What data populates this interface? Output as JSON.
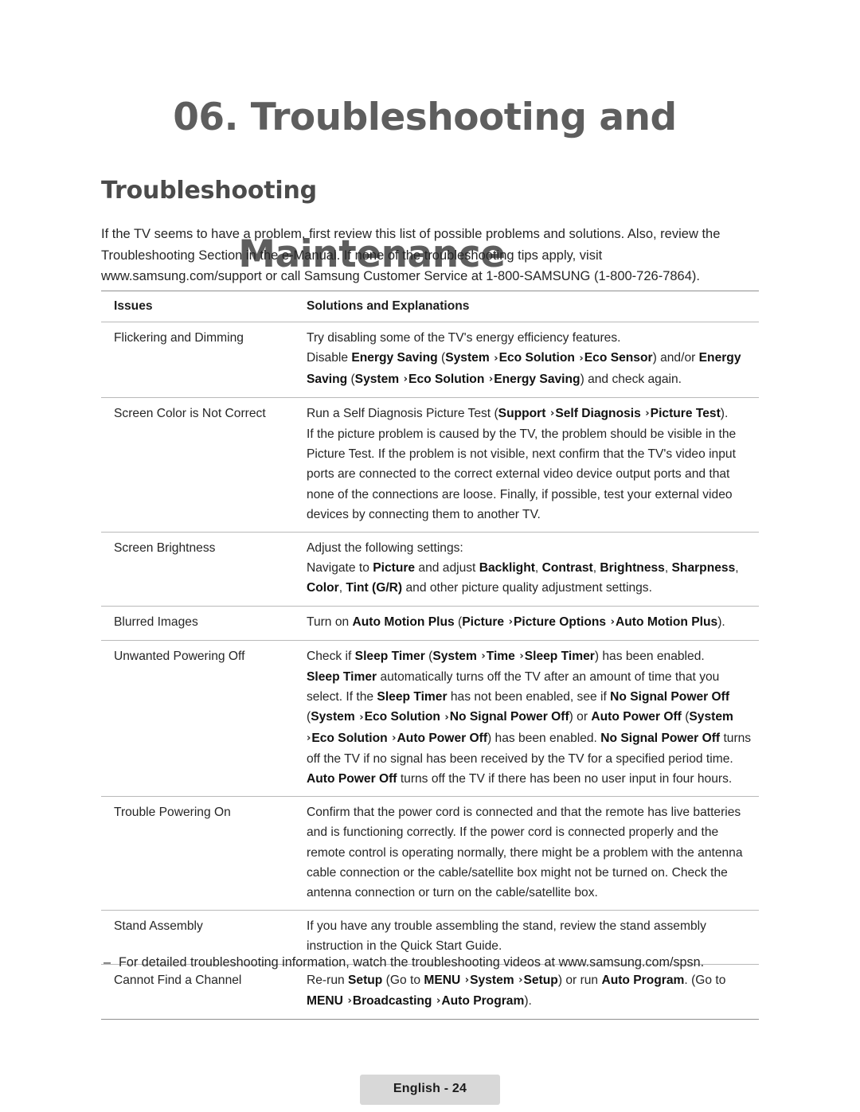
{
  "chapter": {
    "line1": "06. Troubleshooting and",
    "line2": "Maintenance"
  },
  "section": {
    "title": "Troubleshooting"
  },
  "intro": {
    "text": "If the TV seems to have a problem, first review this list of possible problems and solutions. Also, review the Troubleshooting Section in the e-Manual. If none of the troubleshooting tips apply, visit www.samsung.com/support or call Samsung Customer Service at 1-800-SAMSUNG (1-800-726-7864)."
  },
  "table": {
    "headers": {
      "issues": "Issues",
      "solutions": "Solutions and Explanations"
    },
    "rows": [
      {
        "issue": "Flickering and Dimming",
        "paragraphs": [
          [
            {
              "t": "Try disabling some of the TV's energy efficiency features."
            }
          ],
          [
            {
              "t": "Disable "
            },
            {
              "t": "Energy Saving",
              "b": true
            },
            {
              "t": " ("
            },
            {
              "t": "System",
              "b": true
            },
            {
              "t": " ",
              "chev": true
            },
            {
              "t": "Eco Solution",
              "b": true
            },
            {
              "t": " ",
              "chev": true
            },
            {
              "t": "Eco Sensor",
              "b": true
            },
            {
              "t": ") and/or "
            },
            {
              "t": "Energy Saving",
              "b": true
            },
            {
              "t": " ("
            },
            {
              "t": "System",
              "b": true
            },
            {
              "t": " ",
              "chev": true
            },
            {
              "t": "Eco Solution",
              "b": true
            },
            {
              "t": " ",
              "chev": true
            },
            {
              "t": "Energy Saving",
              "b": true
            },
            {
              "t": ") and check again."
            }
          ]
        ]
      },
      {
        "issue": "Screen Color is Not Correct",
        "paragraphs": [
          [
            {
              "t": "Run a Self Diagnosis Picture Test ("
            },
            {
              "t": "Support",
              "b": true
            },
            {
              "t": " ",
              "chev": true
            },
            {
              "t": "Self Diagnosis",
              "b": true
            },
            {
              "t": " ",
              "chev": true
            },
            {
              "t": "Picture Test",
              "b": true
            },
            {
              "t": ")."
            }
          ],
          [
            {
              "t": "If the picture problem is caused by the TV, the problem should be visible in the Picture Test. If the problem is not visible, next confirm that the TV's video input ports are connected to the correct external video device output ports and that none of the connections are loose. Finally, if possible, test your external video devices by connecting them to another TV."
            }
          ]
        ]
      },
      {
        "issue": "Screen Brightness",
        "paragraphs": [
          [
            {
              "t": "Adjust the following settings:"
            }
          ],
          [
            {
              "t": "Navigate to "
            },
            {
              "t": "Picture",
              "b": true
            },
            {
              "t": " and adjust "
            },
            {
              "t": "Backlight",
              "b": true
            },
            {
              "t": ", "
            },
            {
              "t": "Contrast",
              "b": true
            },
            {
              "t": ", "
            },
            {
              "t": "Brightness",
              "b": true
            },
            {
              "t": ", "
            },
            {
              "t": "Sharpness",
              "b": true
            },
            {
              "t": ", "
            },
            {
              "t": "Color",
              "b": true
            },
            {
              "t": ", "
            },
            {
              "t": "Tint (G/R)",
              "b": true
            },
            {
              "t": " and other picture quality adjustment settings."
            }
          ]
        ]
      },
      {
        "issue": "Blurred Images",
        "paragraphs": [
          [
            {
              "t": "Turn on "
            },
            {
              "t": "Auto Motion Plus",
              "b": true
            },
            {
              "t": " ("
            },
            {
              "t": "Picture",
              "b": true
            },
            {
              "t": " ",
              "chev": true
            },
            {
              "t": "Picture Options",
              "b": true
            },
            {
              "t": " ",
              "chev": true
            },
            {
              "t": "Auto Motion Plus",
              "b": true
            },
            {
              "t": ")."
            }
          ]
        ]
      },
      {
        "issue": "Unwanted Powering Off",
        "paragraphs": [
          [
            {
              "t": "Check if "
            },
            {
              "t": "Sleep Timer",
              "b": true
            },
            {
              "t": " ("
            },
            {
              "t": "System",
              "b": true
            },
            {
              "t": " ",
              "chev": true
            },
            {
              "t": "Time",
              "b": true
            },
            {
              "t": " ",
              "chev": true
            },
            {
              "t": "Sleep Timer",
              "b": true
            },
            {
              "t": ") has been enabled."
            }
          ],
          [
            {
              "t": "Sleep Timer",
              "b": true
            },
            {
              "t": " automatically turns off the TV after an amount of time that you select. If the "
            },
            {
              "t": "Sleep Timer",
              "b": true
            },
            {
              "t": " has not been enabled, see if "
            },
            {
              "t": "No Signal Power Off",
              "b": true
            },
            {
              "t": " ("
            },
            {
              "t": "System",
              "b": true
            },
            {
              "t": " ",
              "chev": true
            },
            {
              "t": "Eco Solution",
              "b": true
            },
            {
              "t": " ",
              "chev": true
            },
            {
              "t": "No Signal Power Off",
              "b": true
            },
            {
              "t": ") or "
            },
            {
              "t": "Auto Power Off",
              "b": true
            },
            {
              "t": " ("
            },
            {
              "t": "System",
              "b": true
            },
            {
              "t": " ",
              "chev": true
            },
            {
              "t": "Eco Solution",
              "b": true
            },
            {
              "t": " ",
              "chev": true
            },
            {
              "t": "Auto Power Off",
              "b": true
            },
            {
              "t": ") has been enabled. "
            },
            {
              "t": "No Signal Power Off",
              "b": true
            },
            {
              "t": " turns off the TV if no signal has been received by the TV for a specified period time. "
            },
            {
              "t": "Auto Power Off",
              "b": true
            },
            {
              "t": " turns off the TV if there has been no user input in four hours."
            }
          ]
        ]
      },
      {
        "issue": "Trouble Powering On",
        "paragraphs": [
          [
            {
              "t": "Confirm that the power cord is connected and that the remote has live batteries and is functioning correctly. If the power cord is connected properly and the remote control is operating normally, there might be a problem with the antenna cable connection or the cable/satellite box might not be turned on. Check the antenna connection or turn on the cable/satellite box."
            }
          ]
        ]
      },
      {
        "issue": "Stand Assembly",
        "paragraphs": [
          [
            {
              "t": "If you have any trouble assembling the stand, review the stand assembly instruction in the Quick Start Guide."
            }
          ]
        ]
      },
      {
        "issue": "Cannot Find a Channel",
        "paragraphs": [
          [
            {
              "t": "Re-run "
            },
            {
              "t": "Setup",
              "b": true
            },
            {
              "t": " (Go to "
            },
            {
              "t": "MENU",
              "b": true
            },
            {
              "t": " ",
              "chev": true
            },
            {
              "t": "System",
              "b": true
            },
            {
              "t": " ",
              "chev": true
            },
            {
              "t": "Setup",
              "b": true
            },
            {
              "t": ") or run "
            },
            {
              "t": "Auto Program",
              "b": true
            },
            {
              "t": ". (Go to "
            },
            {
              "t": "MENU",
              "b": true
            },
            {
              "t": " ",
              "chev": true
            },
            {
              "t": "Broadcasting",
              "b": true
            },
            {
              "t": " ",
              "chev": true
            },
            {
              "t": "Auto Program",
              "b": true
            },
            {
              "t": ")."
            }
          ]
        ]
      }
    ]
  },
  "footnote": {
    "dash": "–",
    "text": "For detailed troubleshooting information, watch the troubleshooting videos at www.samsung.com/spsn."
  },
  "footer": {
    "page_label": "English - 24"
  }
}
